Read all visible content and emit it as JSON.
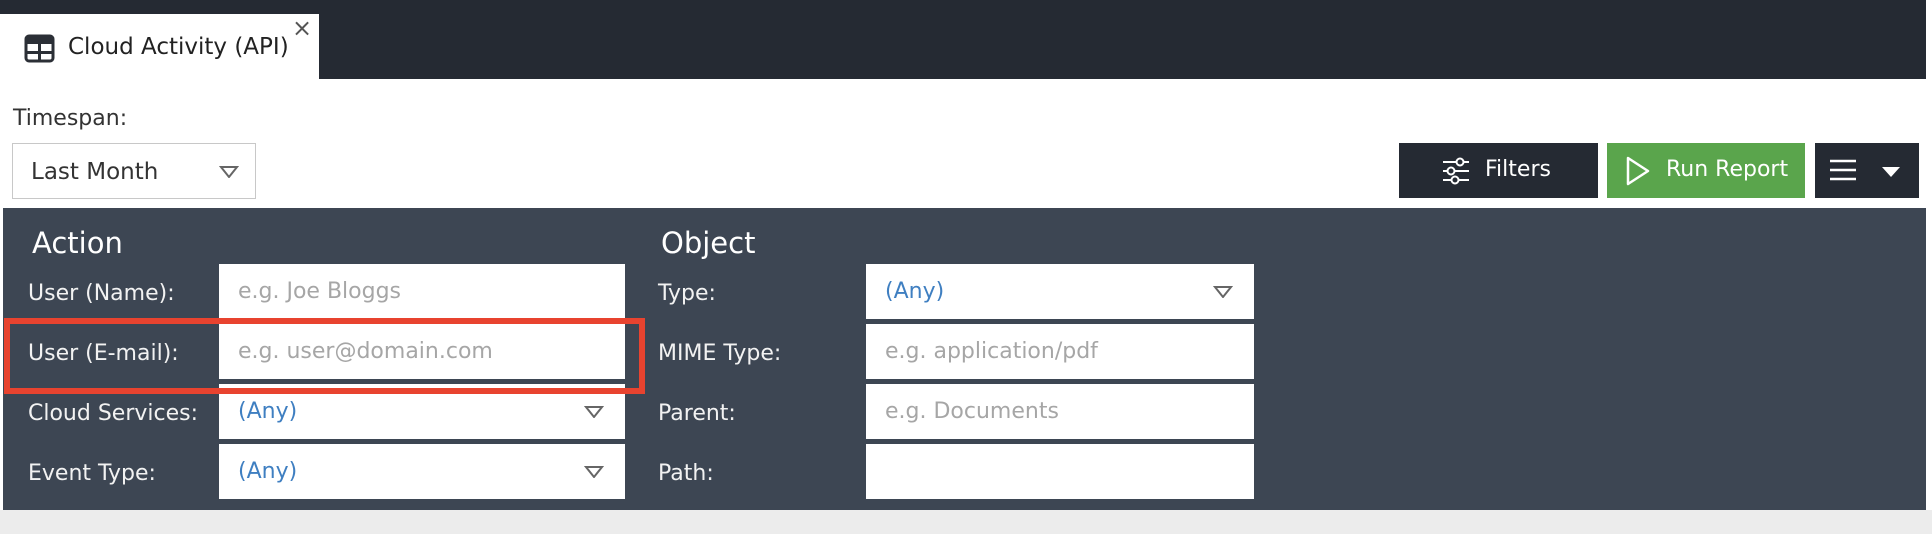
{
  "tab": {
    "title": "Cloud Activity (API)",
    "close_glyph": "×",
    "icon": "table-icon"
  },
  "timespan": {
    "label": "Timespan:",
    "value": "Last Month"
  },
  "toolbar": {
    "filters_label": "Filters",
    "run_label": "Run Report",
    "menu_icon": "hamburger-icon"
  },
  "action": {
    "heading": "Action",
    "user_name_label": "User (Name):",
    "user_name_placeholder": "e.g. Joe Bloggs",
    "user_email_label": "User (E-mail):",
    "user_email_placeholder": "e.g. user@domain.com",
    "cloud_services_label": "Cloud Services:",
    "cloud_services_value": "(Any)",
    "event_type_label": "Event Type:",
    "event_type_value": "(Any)"
  },
  "object": {
    "heading": "Object",
    "type_label": "Type:",
    "type_value": "(Any)",
    "mime_label": "MIME Type:",
    "mime_placeholder": "e.g. application/pdf",
    "parent_label": "Parent:",
    "parent_placeholder": "e.g. Documents",
    "path_label": "Path:",
    "path_value": ""
  },
  "colors": {
    "topbar": "#252a33",
    "panel": "#3d4653",
    "run_button": "#5aa54c",
    "highlight": "#e8432f",
    "any_value": "#3f7fc1"
  }
}
